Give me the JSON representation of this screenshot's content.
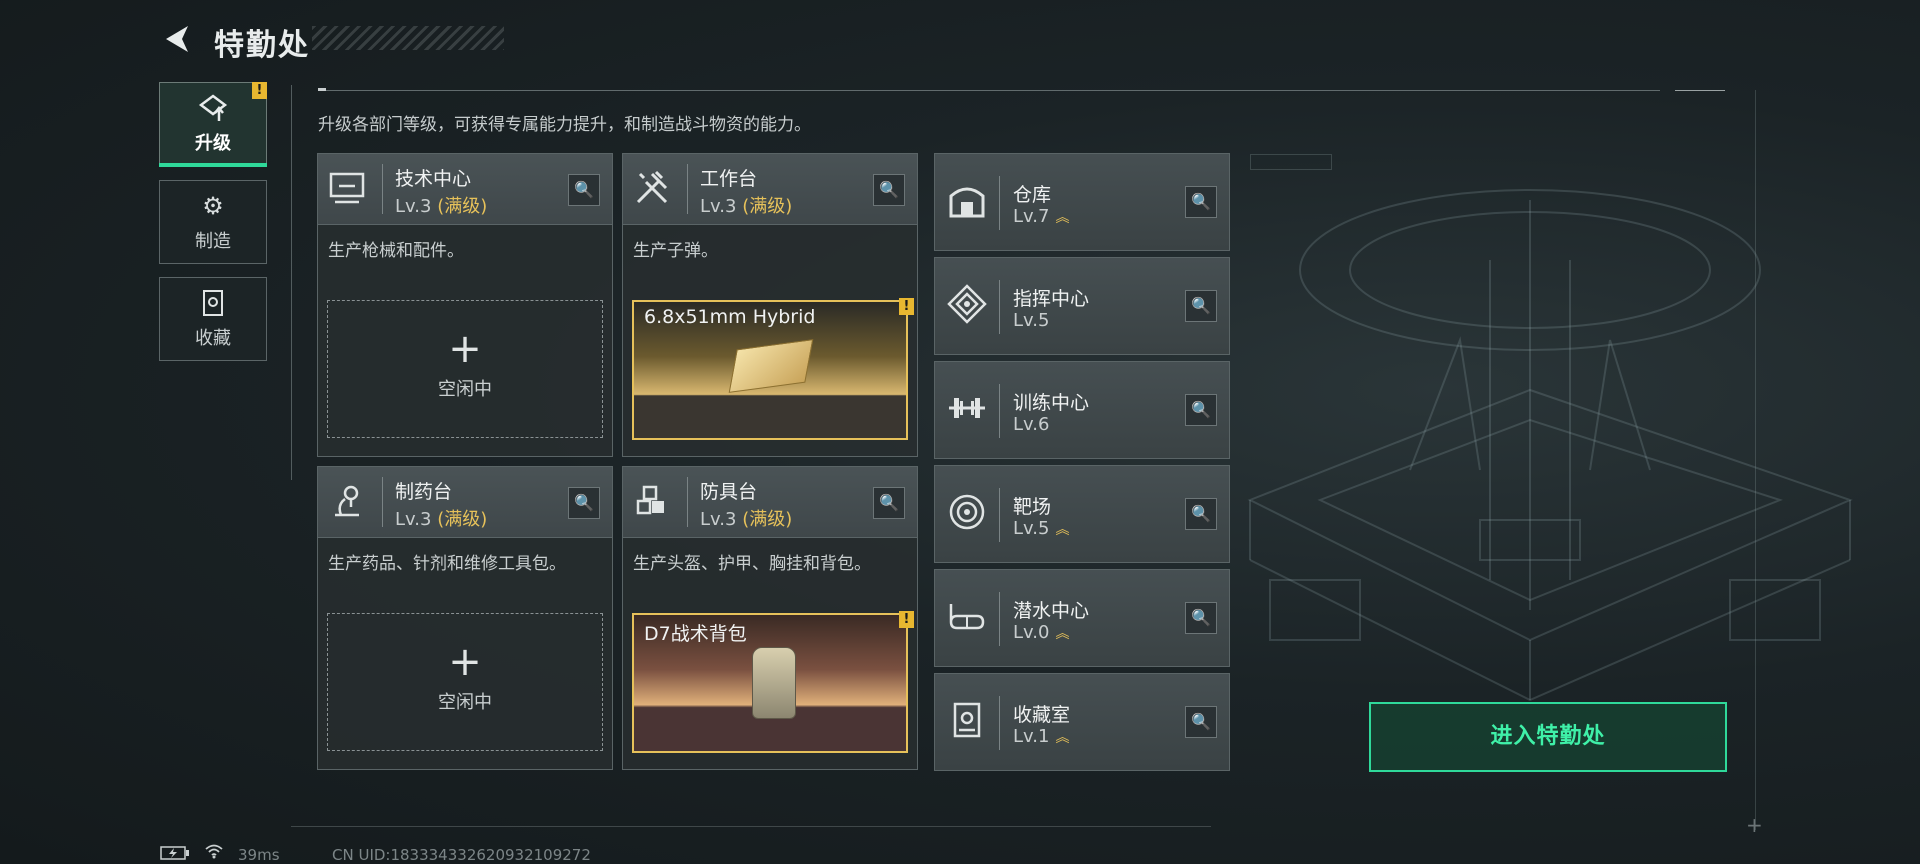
{
  "header": {
    "title": "特勤处"
  },
  "nav": [
    {
      "label": "升级",
      "icon": "upgrade-icon",
      "active": true,
      "warning": "!"
    },
    {
      "label": "制造",
      "icon": "gears-icon",
      "active": false
    },
    {
      "label": "收藏",
      "icon": "collection-icon",
      "active": false
    }
  ],
  "description": "升级各部门等级，可获得专属能力提升，和制造战斗物资的能力。",
  "stations": [
    {
      "name": "技术中心",
      "level": "Lv.3",
      "max": "(满级)",
      "desc": "生产枪械和配件。",
      "slot": {
        "plus": "+",
        "label": "空闲中"
      }
    },
    {
      "name": "工作台",
      "level": "Lv.3",
      "max": "(满级)",
      "desc": "生产子弹。",
      "product": {
        "name": "6.8x51mm Hybrid",
        "warning": "!"
      }
    },
    {
      "name": "制药台",
      "level": "Lv.3",
      "max": "(满级)",
      "desc": "生产药品、针剂和维修工具包。",
      "slot": {
        "plus": "+",
        "label": "空闲中"
      }
    },
    {
      "name": "防具台",
      "level": "Lv.3",
      "max": "(满级)",
      "desc": "生产头盔、护甲、胸挂和背包。",
      "product": {
        "name": "D7战术背包",
        "warning": "!"
      }
    }
  ],
  "facilities": [
    {
      "name": "仓库",
      "level": "Lv.7",
      "upgradable": true
    },
    {
      "name": "指挥中心",
      "level": "Lv.5",
      "upgradable": false
    },
    {
      "name": "训练中心",
      "level": "Lv.6",
      "upgradable": false
    },
    {
      "name": "靶场",
      "level": "Lv.5",
      "upgradable": true
    },
    {
      "name": "潜水中心",
      "level": "Lv.0",
      "upgradable": true
    },
    {
      "name": "收藏室",
      "level": "Lv.1",
      "upgradable": true
    }
  ],
  "enter_button": "进入特勤处",
  "footer": {
    "ping": "39ms",
    "uid": "CN UID:18333433262093210927​2"
  },
  "colors": {
    "accent_green": "#2fd99a",
    "gold": "#e6c15a",
    "warning": "#e8b730"
  },
  "icons": {
    "back": "back-arrow-icon",
    "search": "search-icon",
    "upgrade_arrows": "chevron-up-icon"
  }
}
